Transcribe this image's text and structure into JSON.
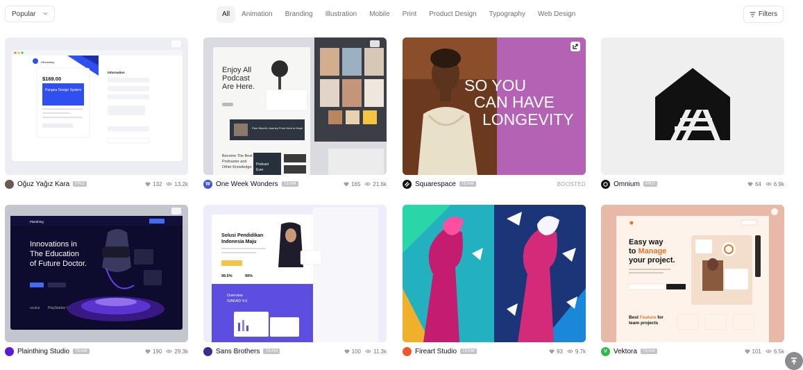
{
  "filter_bar": {
    "sort_value": "Popular",
    "categories": [
      "All",
      "Animation",
      "Branding",
      "Illustration",
      "Mobile",
      "Print",
      "Product Design",
      "Typography",
      "Web Design"
    ],
    "active_category": "All",
    "filters_label": "Filters"
  },
  "shots": [
    {
      "author": "Oğuz Yağız Kara",
      "badge": "PRO",
      "likes": "132",
      "views": "13.2k",
      "preview": {
        "brand": "Viluxeshop",
        "price": "$169.00",
        "product": "Pangea Design System",
        "panel_title": "Information"
      }
    },
    {
      "author": "One Week Wonders",
      "badge": "TEAM",
      "likes": "165",
      "views": "21.6k",
      "preview": {
        "headline_1": "Enjoy All",
        "headline_2": "Podcast",
        "headline_3": "Are Here.",
        "episode": "Pam Wood's Journey From Hero to Hope",
        "section_1": "Become The Best",
        "section_2": "Podcaster and",
        "section_3": "Other Knowledge",
        "sub_1": "Podcast",
        "sub_2": "Ever"
      }
    },
    {
      "author": "Squarespace",
      "badge": "TEAM",
      "boosted": "BOOSTED",
      "preview": {
        "line_1": "SO YOU",
        "line_2": "CAN HAVE",
        "line_3": "LONGEVITY"
      }
    },
    {
      "author": "Omnium",
      "badge": "PRO",
      "likes": "64",
      "views": "6.9k",
      "preview": {}
    },
    {
      "author": "Plainthing Studio",
      "badge": "TEAM",
      "likes": "190",
      "views": "29.3k",
      "preview": {
        "brand": "Plainthing",
        "line_1": "Innovations in",
        "line_2": "The Education",
        "line_3": "of Future Doctor.",
        "partner_1": "oculus",
        "partner_2": "PlayStation VR"
      }
    },
    {
      "author": "Sans Brothers",
      "badge": "TEAM",
      "likes": "100",
      "views": "11.3k",
      "preview": {
        "line_1": "Solusi Pendidikan",
        "line_2": "Indonesia Maju",
        "stat_1": "99.5%",
        "stat_2": "99%",
        "overview_1": "Overview",
        "overview_2": "SIAKAD 4.0"
      }
    },
    {
      "author": "Fireart Studio",
      "badge": "TEAM",
      "likes": "93",
      "views": "9.7k",
      "preview": {}
    },
    {
      "author": "Vektora",
      "badge": "TEAM",
      "likes": "101",
      "views": "6.5k",
      "preview": {
        "line_1": "Easy way",
        "line_2": "to ",
        "line_2_accent": "Manage",
        "line_3": "your project.",
        "feature_1": "Best ",
        "feature_accent": "Feature",
        "feature_2": " for",
        "feature_3": "team projects"
      }
    }
  ],
  "colors": {
    "accent_pink": "#ea4c89",
    "manage_orange": "#e8742b",
    "squarespace_purple": "#b463b4"
  }
}
